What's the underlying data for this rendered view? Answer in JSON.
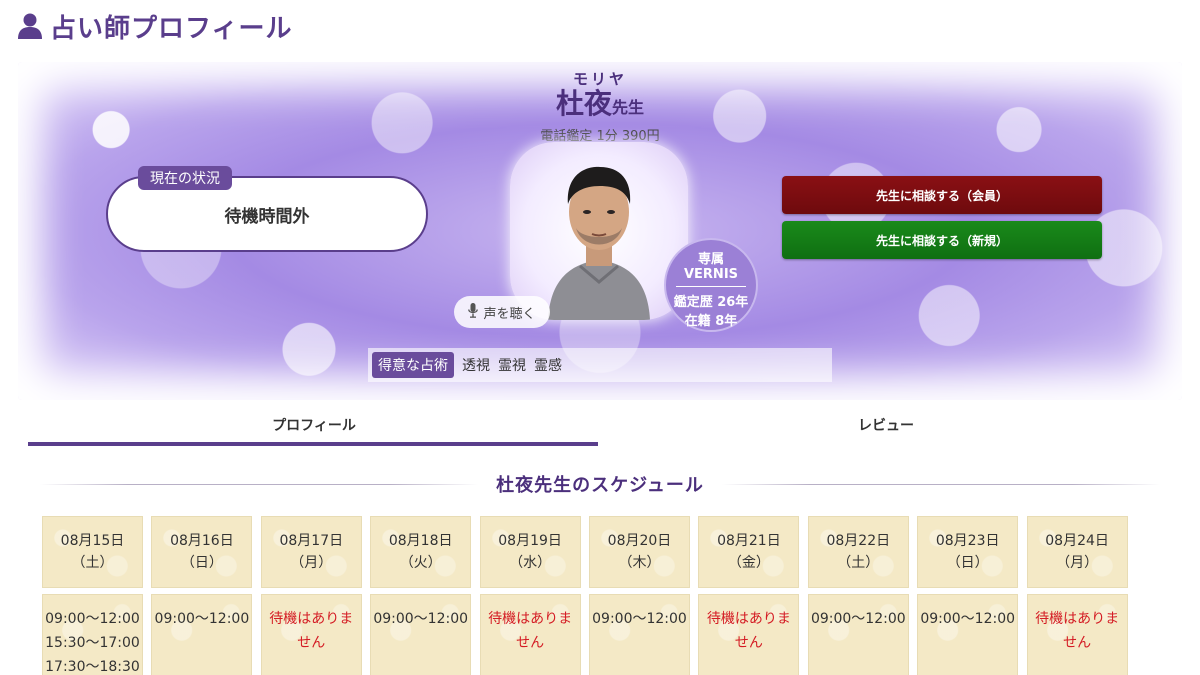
{
  "page": {
    "title": "占い師プロフィール",
    "icon": "user-icon"
  },
  "fortune_teller": {
    "furigana": "モリヤ",
    "name": "杜夜",
    "honorific": "先生",
    "rate": "電話鑑定 1分 390円",
    "status_label": "現在の状況",
    "status_value": "待機時間外",
    "voice_button": "声を聴く",
    "badge": {
      "line1": "専属",
      "line2": "VERNIS",
      "line3": "鑑定歴 26年",
      "line4": "在籍 8年"
    },
    "specialty_label": "得意な占術",
    "specialties": [
      "透視",
      "霊視",
      "霊感"
    ]
  },
  "buttons": {
    "consult_member": "先生に相談する（会員）",
    "consult_new": "先生に相談する（新規）"
  },
  "colors": {
    "brand": "#5a3e8c",
    "member_button": "#7a0d10",
    "new_button": "#168016",
    "unavailable_text": "#d41c24"
  },
  "tabs": [
    {
      "label": "プロフィール",
      "active": true
    },
    {
      "label": "レビュー",
      "active": false
    }
  ],
  "schedule": {
    "title": "杜夜先生のスケジュール",
    "days": [
      {
        "date": "08月15日",
        "weekday": "（土）",
        "slots": [
          "09:00〜12:00",
          "15:30〜17:00",
          "17:30〜18:30"
        ]
      },
      {
        "date": "08月16日",
        "weekday": "（日）",
        "slots": [
          "09:00〜12:00"
        ]
      },
      {
        "date": "08月17日",
        "weekday": "（月）",
        "slots": [
          "待機はありません"
        ]
      },
      {
        "date": "08月18日",
        "weekday": "（火）",
        "slots": [
          "09:00〜12:00"
        ]
      },
      {
        "date": "08月19日",
        "weekday": "（水）",
        "slots": [
          "待機はありません"
        ]
      },
      {
        "date": "08月20日",
        "weekday": "（木）",
        "slots": [
          "09:00〜12:00"
        ]
      },
      {
        "date": "08月21日",
        "weekday": "（金）",
        "slots": [
          "待機はありません"
        ]
      },
      {
        "date": "08月22日",
        "weekday": "（土）",
        "slots": [
          "09:00〜12:00"
        ]
      },
      {
        "date": "08月23日",
        "weekday": "（日）",
        "slots": [
          "09:00〜12:00"
        ]
      },
      {
        "date": "08月24日",
        "weekday": "（月）",
        "slots": [
          "待機はありません"
        ]
      }
    ]
  }
}
